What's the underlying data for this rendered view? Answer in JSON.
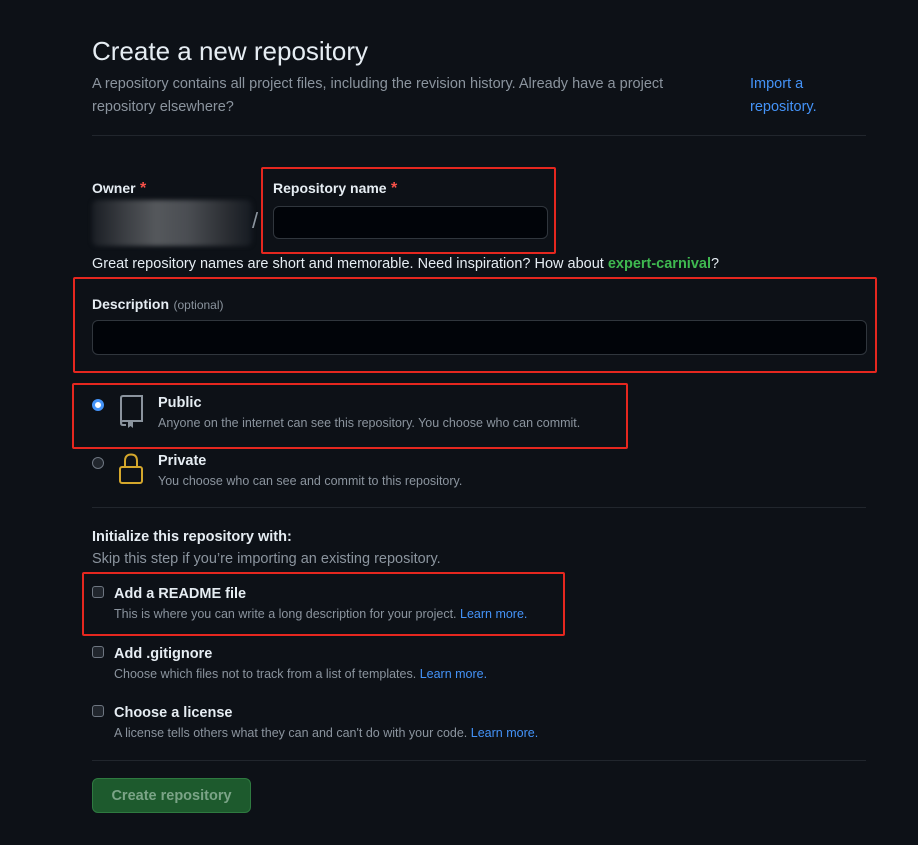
{
  "header": {
    "title": "Create a new repository",
    "subtitle": "A repository contains all project files, including the revision history. Already have a project repository elsewhere?",
    "import_link": "Import a repository."
  },
  "owner": {
    "label": "Owner",
    "required_mark": "*",
    "separator": "/"
  },
  "repo_name": {
    "label": "Repository name",
    "required_mark": "*",
    "value": ""
  },
  "name_hint": {
    "text": "Great repository names are short and memorable. Need inspiration? How about ",
    "suggestion": "expert-carnival",
    "suffix": "?"
  },
  "description": {
    "label": "Description",
    "optional": "(optional)",
    "value": ""
  },
  "visibility": {
    "selected": "public",
    "options": [
      {
        "title": "Public",
        "desc": "Anyone on the internet can see this repository. You choose who can commit.",
        "icon": "repo-book-icon"
      },
      {
        "title": "Private",
        "desc": "You choose who can see and commit to this repository.",
        "icon": "lock-icon"
      }
    ]
  },
  "init": {
    "title": "Initialize this repository with:",
    "subtitle": "Skip this step if you’re importing an existing repository.",
    "options": [
      {
        "title": "Add a README file",
        "desc": "This is where you can write a long description for your project. ",
        "learn": "Learn more.",
        "checked": false
      },
      {
        "title": "Add .gitignore",
        "desc": "Choose which files not to track from a list of templates. ",
        "learn": "Learn more.",
        "checked": false
      },
      {
        "title": "Choose a license",
        "desc": "A license tells others what they can and can't do with your code. ",
        "learn": "Learn more.",
        "checked": false
      }
    ]
  },
  "submit": {
    "label": "Create repository"
  },
  "colors": {
    "accent": "#4493f8",
    "danger": "#e5271f",
    "success": "#3fb950",
    "background": "#0d1117"
  }
}
